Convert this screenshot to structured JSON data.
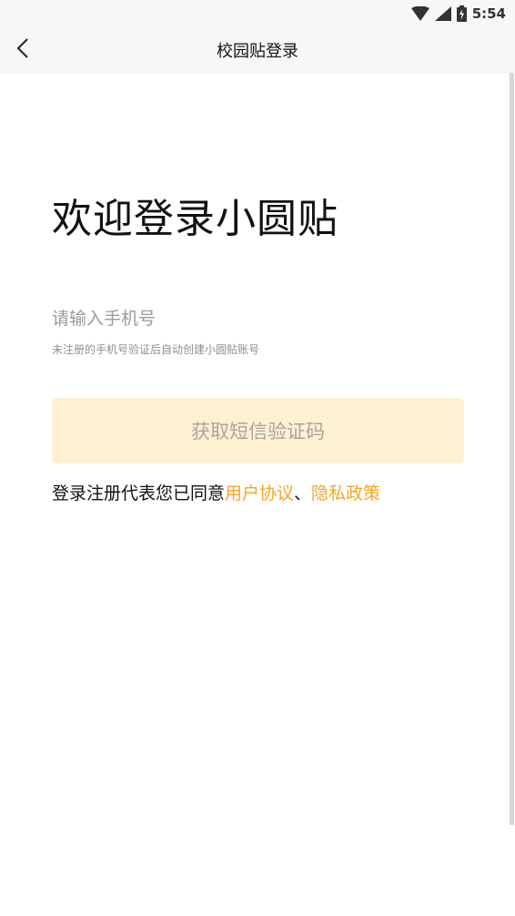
{
  "status_bar": {
    "time": "5:54",
    "icons": [
      "wifi-icon",
      "cell-signal-icon",
      "battery-icon"
    ]
  },
  "header": {
    "title": "校园贴登录",
    "back_icon": "chevron-left-icon"
  },
  "main": {
    "welcome": "欢迎登录小圆贴",
    "phone_placeholder": "请输入手机号",
    "phone_value": "",
    "hint": "未注册的手机号验证后自动创建小圆贴账号",
    "code_button": "获取短信验证码",
    "agreement": {
      "prefix": "登录注册代表您已同意",
      "user_agreement": "用户协议",
      "separator": "、",
      "privacy_policy": "隐私政策"
    }
  },
  "colors": {
    "accent": "#f5a623",
    "button_bg": "#fdf1d2",
    "button_text": "#a9a59a",
    "header_bg": "#f7f7f7"
  }
}
